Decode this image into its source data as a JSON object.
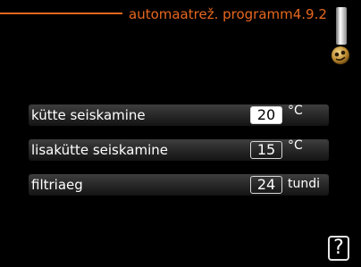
{
  "header": {
    "title": "automaatrež. programm4.9.2"
  },
  "icons": {
    "slider": "scroll-slider-icon",
    "knob": "knob-face-icon",
    "help": "help-icon"
  },
  "rows": [
    {
      "label": "kütte seiskamine",
      "value": "20",
      "unit": "°C",
      "selected": true
    },
    {
      "label": "lisakütte seiskamine",
      "value": "15",
      "unit": "°C",
      "selected": false
    },
    {
      "label": "filtriaeg",
      "value": "24",
      "unit": "tundi",
      "selected": false
    }
  ],
  "help": {
    "label": "?"
  },
  "colors": {
    "accent": "#e8671e",
    "background": "#000000"
  }
}
